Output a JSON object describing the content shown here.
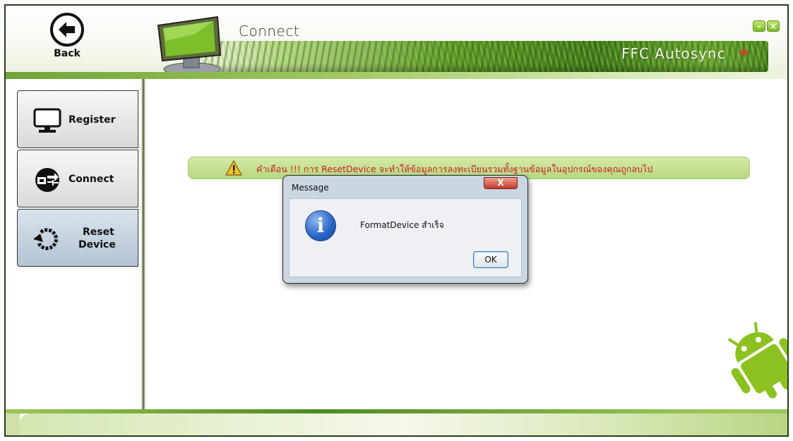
{
  "header": {
    "back_label": "Back",
    "title": "Connect",
    "brand": "FFC Autosync",
    "brand_plus": "+",
    "minimize_symbol": "–",
    "close_symbol": "×"
  },
  "sidebar": {
    "items": [
      {
        "label": "Register",
        "icon": "monitor-icon",
        "active": false
      },
      {
        "label": "Connect",
        "icon": "connect-icon",
        "active": false
      },
      {
        "label_line1": "Reset",
        "label_line2": "Device",
        "icon": "reset-icon",
        "active": true
      }
    ]
  },
  "warning": {
    "text": "คำเตือน !!! การ ResetDevice จะทำให้ข้อมูลการลงทะเบียนรวมทั้งฐานข้อมูลในอุปกรณ์ของคุณถูกลบไป"
  },
  "dialog": {
    "title": "Message",
    "close_symbol": "X",
    "message": "FormatDevice สำเร็จ",
    "ok_label": "OK",
    "info_symbol": "i"
  },
  "colors": {
    "accent_green": "#6fa33a",
    "warning_text": "#c82020",
    "dialog_bg": "#cad6e2"
  }
}
